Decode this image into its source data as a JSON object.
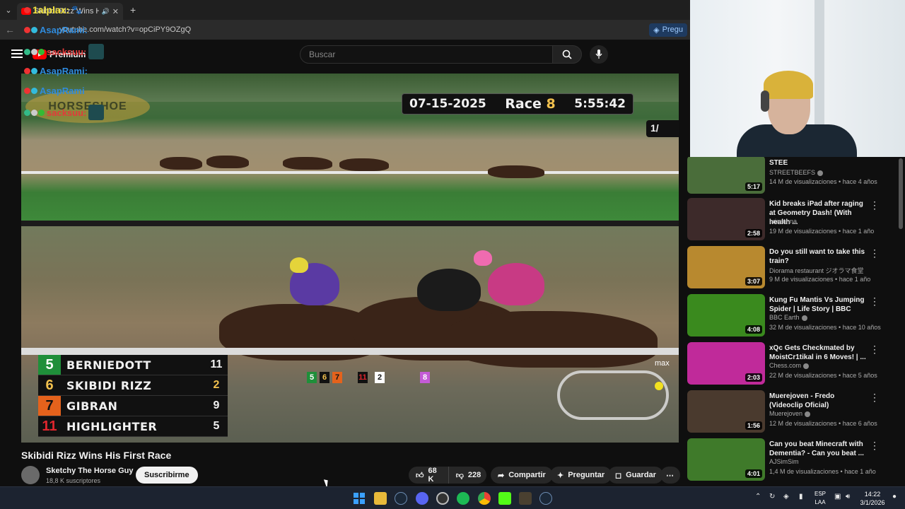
{
  "browser": {
    "tab_title": "Skibidi Rizz Wins His First Race",
    "url": "youtube.com/watch?v=opCiPY9OZgQ",
    "ask_label": "Pregu"
  },
  "youtube": {
    "premium_label": "Premium",
    "search_placeholder": "Buscar"
  },
  "stream_overlay": {
    "lines": [
      {
        "user": "1alplax:"
      },
      {
        "user": "AsapRami:"
      },
      {
        "user": "sacksuu:"
      },
      {
        "user": "AsapRami:"
      },
      {
        "user": "AsapRami"
      },
      {
        "user": "sacksuu:"
      }
    ],
    "horseshoe_text": "HORSESHOE"
  },
  "video": {
    "date": "07-15-2025",
    "race_label": "Race",
    "race_number": "8",
    "time": "5:55:42",
    "quarter": "1/",
    "watermark": "max",
    "standings": [
      {
        "num": "5",
        "name": "BERNIEDOTT",
        "pos": "11",
        "color": "#1f8f3a",
        "num_color": "#ffffff"
      },
      {
        "num": "6",
        "name": "SKIBIDI RIZZ",
        "pos": "2",
        "color": "#111111",
        "num_color": "#f2c14e"
      },
      {
        "num": "7",
        "name": "GIBRAN",
        "pos": "9",
        "color": "#e4621c",
        "num_color": "#111111"
      },
      {
        "num": "11",
        "name": "HIGHLIGHTER",
        "pos": "5",
        "color": "#111111",
        "num_color": "#e0262e"
      }
    ],
    "mini_numbers": [
      "5",
      "6",
      "7",
      "11",
      "2",
      "8"
    ],
    "title": "Skibidi Rizz Wins His First Race"
  },
  "channel": {
    "name": "Sketchy The Horse Guy",
    "subscribers": "18,8 K suscriptores",
    "subscribe_label": "Suscribirme"
  },
  "actions": {
    "likes": "68 K",
    "dislikes": "228",
    "share": "Compartir",
    "ask": "Preguntar",
    "save": "Guardar"
  },
  "sidebar": {
    "items": [
      {
        "title": "STEE",
        "channel": "STREETBEEFS",
        "meta": "14 M de visualizaciones • hace 4 años",
        "duration": "5:17",
        "thumb": "#4a6d3a",
        "verified": true
      },
      {
        "title": "Kid breaks iPad after raging at Geometry Dash! (With health ...",
        "channel": "brissanna",
        "meta": "19 M de visualizaciones • hace 1 año",
        "duration": "2:58",
        "thumb": "#3d2a2a",
        "verified": false
      },
      {
        "title": "Do you still want to take this train?",
        "channel": "Diorama restaurant ジオラマ食堂",
        "meta": "9 M de visualizaciones • hace 1 año",
        "duration": "3:07",
        "thumb": "#b8892f",
        "verified": false
      },
      {
        "title": "Kung Fu Mantis Vs Jumping Spider | Life Story | BBC",
        "channel": "BBC Earth",
        "meta": "32 M de visualizaciones • hace 10 años",
        "duration": "4:08",
        "thumb": "#3a8a1e",
        "verified": true
      },
      {
        "title": "xQc Gets Checkmated by MoistCr1tikal in 6 Moves! | ...",
        "channel": "Chess.com",
        "meta": "22 M de visualizaciones • hace 5 años",
        "duration": "2:03",
        "thumb": "#c02a9a",
        "verified": true
      },
      {
        "title": "Muerejoven - Fredo (Videoclip Oficial)",
        "channel": "Muerejoven",
        "meta": "12 M de visualizaciones • hace 6 años",
        "duration": "1:56",
        "thumb": "#4a3a2e",
        "verified": true
      },
      {
        "title": "Can you beat Minecraft with Dementia? - Can you beat ...",
        "channel": "AJSimSim",
        "meta": "1,4 M de visualizaciones • hace 1 año",
        "duration": "4:01",
        "thumb": "#3f7a2a",
        "verified": false
      }
    ]
  },
  "taskbar": {
    "lang_top": "ESP",
    "lang_bottom": "LAA",
    "time": "14:22",
    "date": "3/1/2026"
  }
}
